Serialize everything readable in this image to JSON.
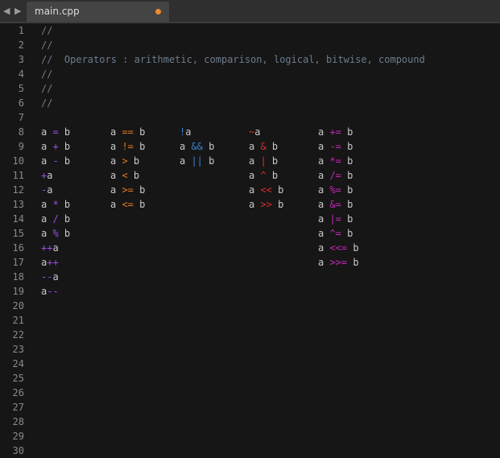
{
  "tab": {
    "title": "main.cpp",
    "modified": true
  },
  "nav": {
    "back": "◀",
    "forward": "▶"
  },
  "colors": {
    "text": "#c8c8c8",
    "comment": "#6c7c8c",
    "arith": "#9a4cf0",
    "comp": "#e07a1f",
    "logic": "#3a80c8",
    "bit": "#e02a2a",
    "compound": "#c02ab8",
    "modified_dot": "#f08a30"
  },
  "lines": [
    [
      [
        [
          "//",
          "comment"
        ]
      ]
    ],
    [
      [
        [
          "//",
          "comment"
        ]
      ]
    ],
    [
      [
        [
          "//  Operators : arithmetic, comparison, logical, bitwise, compound",
          "comment"
        ]
      ]
    ],
    [
      [
        [
          "//",
          "comment"
        ]
      ]
    ],
    [
      [
        [
          "//",
          "comment"
        ]
      ]
    ],
    [
      [
        [
          "//",
          "comment"
        ]
      ]
    ],
    [],
    [
      [
        [
          "a ",
          "text"
        ],
        [
          "=",
          "arith"
        ],
        [
          " b",
          "text"
        ]
      ],
      [
        [
          "a ",
          "text"
        ],
        [
          "==",
          "comp"
        ],
        [
          " b",
          "text"
        ]
      ],
      [
        [
          "!",
          "logic"
        ],
        [
          "a",
          "text"
        ]
      ],
      [
        [
          "~",
          "bit"
        ],
        [
          "a",
          "text"
        ]
      ],
      [
        [
          "a ",
          "text"
        ],
        [
          "+=",
          "compound"
        ],
        [
          " b",
          "text"
        ]
      ]
    ],
    [
      [
        [
          "a ",
          "text"
        ],
        [
          "+",
          "arith"
        ],
        [
          " b",
          "text"
        ]
      ],
      [
        [
          "a ",
          "text"
        ],
        [
          "!=",
          "comp"
        ],
        [
          " b",
          "text"
        ]
      ],
      [
        [
          "a ",
          "text"
        ],
        [
          "&&",
          "logic"
        ],
        [
          " b",
          "text"
        ]
      ],
      [
        [
          "a ",
          "text"
        ],
        [
          "&",
          "bit"
        ],
        [
          " b",
          "text"
        ]
      ],
      [
        [
          "a ",
          "text"
        ],
        [
          "-=",
          "compound"
        ],
        [
          " b",
          "text"
        ]
      ]
    ],
    [
      [
        [
          "a ",
          "text"
        ],
        [
          "-",
          "arith"
        ],
        [
          " b",
          "text"
        ]
      ],
      [
        [
          "a ",
          "text"
        ],
        [
          ">",
          "comp"
        ],
        [
          " b",
          "text"
        ]
      ],
      [
        [
          "a ",
          "text"
        ],
        [
          "||",
          "logic"
        ],
        [
          " b",
          "text"
        ]
      ],
      [
        [
          "a ",
          "text"
        ],
        [
          "|",
          "bit"
        ],
        [
          " b",
          "text"
        ]
      ],
      [
        [
          "a ",
          "text"
        ],
        [
          "*=",
          "compound"
        ],
        [
          " b",
          "text"
        ]
      ]
    ],
    [
      [
        [
          "+",
          "arith"
        ],
        [
          "a",
          "text"
        ]
      ],
      [
        [
          "a ",
          "text"
        ],
        [
          "<",
          "comp"
        ],
        [
          " b",
          "text"
        ]
      ],
      [],
      [
        [
          "a ",
          "text"
        ],
        [
          "^",
          "bit"
        ],
        [
          " b",
          "text"
        ]
      ],
      [
        [
          "a ",
          "text"
        ],
        [
          "/=",
          "compound"
        ],
        [
          " b",
          "text"
        ]
      ]
    ],
    [
      [
        [
          "-",
          "arith"
        ],
        [
          "a",
          "text"
        ]
      ],
      [
        [
          "a ",
          "text"
        ],
        [
          ">=",
          "comp"
        ],
        [
          " b",
          "text"
        ]
      ],
      [],
      [
        [
          "a ",
          "text"
        ],
        [
          "<<",
          "bit"
        ],
        [
          " b",
          "text"
        ]
      ],
      [
        [
          "a ",
          "text"
        ],
        [
          "%=",
          "compound"
        ],
        [
          " b",
          "text"
        ]
      ]
    ],
    [
      [
        [
          "a ",
          "text"
        ],
        [
          "*",
          "arith"
        ],
        [
          " b",
          "text"
        ]
      ],
      [
        [
          "a ",
          "text"
        ],
        [
          "<=",
          "comp"
        ],
        [
          " b",
          "text"
        ]
      ],
      [],
      [
        [
          "a ",
          "text"
        ],
        [
          ">>",
          "bit"
        ],
        [
          " b",
          "text"
        ]
      ],
      [
        [
          "a ",
          "text"
        ],
        [
          "&=",
          "compound"
        ],
        [
          " b",
          "text"
        ]
      ]
    ],
    [
      [
        [
          "a ",
          "text"
        ],
        [
          "/",
          "arith"
        ],
        [
          " b",
          "text"
        ]
      ],
      [],
      [],
      [],
      [
        [
          "a ",
          "text"
        ],
        [
          "|=",
          "compound"
        ],
        [
          " b",
          "text"
        ]
      ]
    ],
    [
      [
        [
          "a ",
          "text"
        ],
        [
          "%",
          "arith"
        ],
        [
          " b",
          "text"
        ]
      ],
      [],
      [],
      [],
      [
        [
          "a ",
          "text"
        ],
        [
          "^=",
          "compound"
        ],
        [
          " b",
          "text"
        ]
      ]
    ],
    [
      [
        [
          "++",
          "arith"
        ],
        [
          "a",
          "text"
        ]
      ],
      [],
      [],
      [],
      [
        [
          "a ",
          "text"
        ],
        [
          "<<=",
          "compound"
        ],
        [
          " b",
          "text"
        ]
      ]
    ],
    [
      [
        [
          "a",
          "text"
        ],
        [
          "++",
          "arith"
        ]
      ],
      [],
      [],
      [],
      [
        [
          "a ",
          "text"
        ],
        [
          ">>=",
          "compound"
        ],
        [
          " b",
          "text"
        ]
      ]
    ],
    [
      [
        [
          "--",
          "arith"
        ],
        [
          "a",
          "text"
        ]
      ]
    ],
    [
      [
        [
          "a",
          "text"
        ],
        [
          "--",
          "arith"
        ]
      ]
    ],
    [],
    [],
    [],
    [],
    [],
    [],
    [],
    [],
    [],
    [],
    []
  ]
}
